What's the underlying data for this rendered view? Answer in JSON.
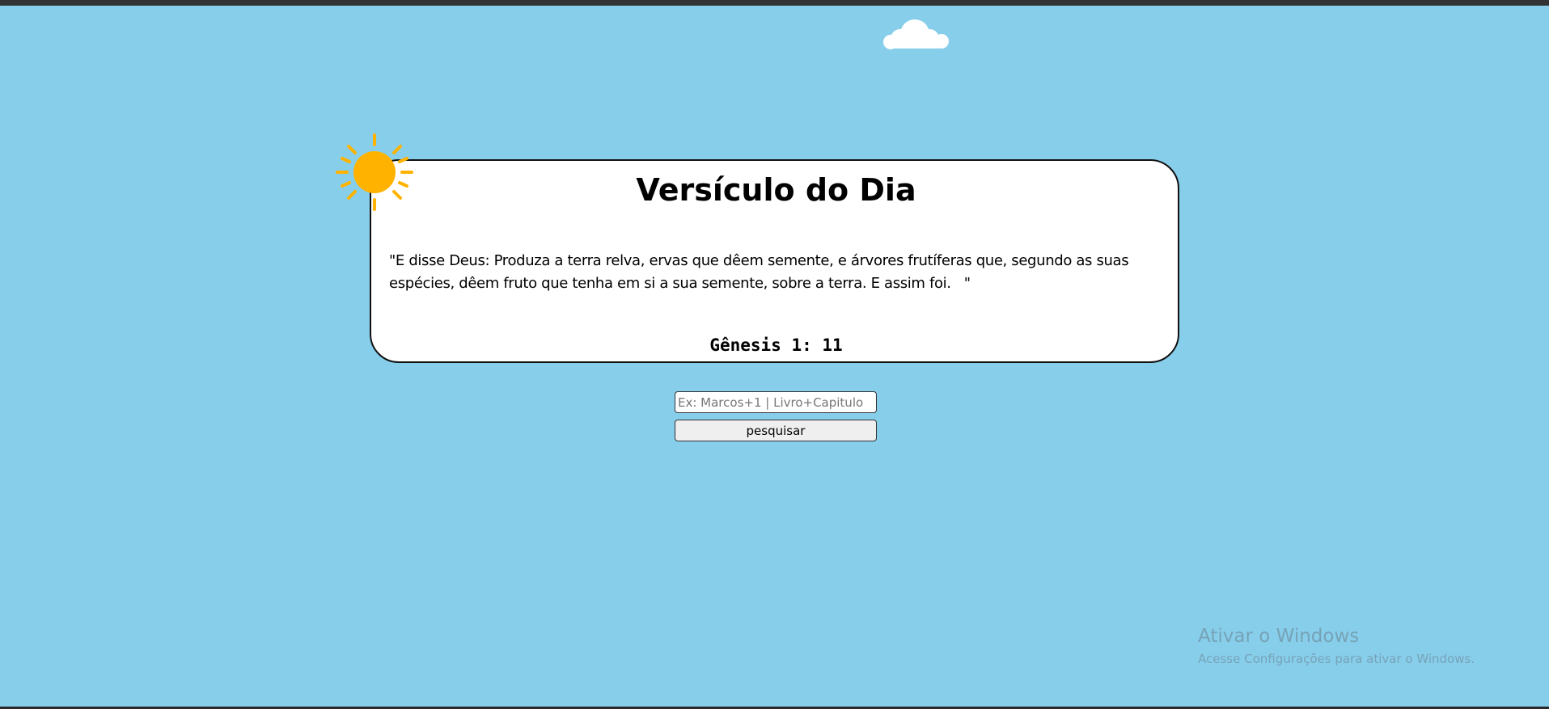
{
  "page": {
    "background_color": "#87ceeb"
  },
  "decorations": {
    "sun_icon": "sun-icon",
    "cloud_icon": "cloud-icon",
    "sun_color": "#ffb300"
  },
  "verse_card": {
    "title": "Versículo do Dia",
    "verse": "\"E disse Deus: Produza a terra relva, ervas que dêem semente, e árvores frutíferas que, segundo as suas espécies, dêem fruto que tenha em si a sua semente, sobre a terra. E assim foi.   \"",
    "reference": "Gênesis 1: 11"
  },
  "search": {
    "placeholder": "Ex: Marcos+1 | Livro+Capitulo",
    "value": "",
    "button_label": "pesquisar"
  },
  "windows_activation": {
    "title": "Ativar o Windows",
    "subtitle": "Acesse Configurações para ativar o Windows."
  }
}
